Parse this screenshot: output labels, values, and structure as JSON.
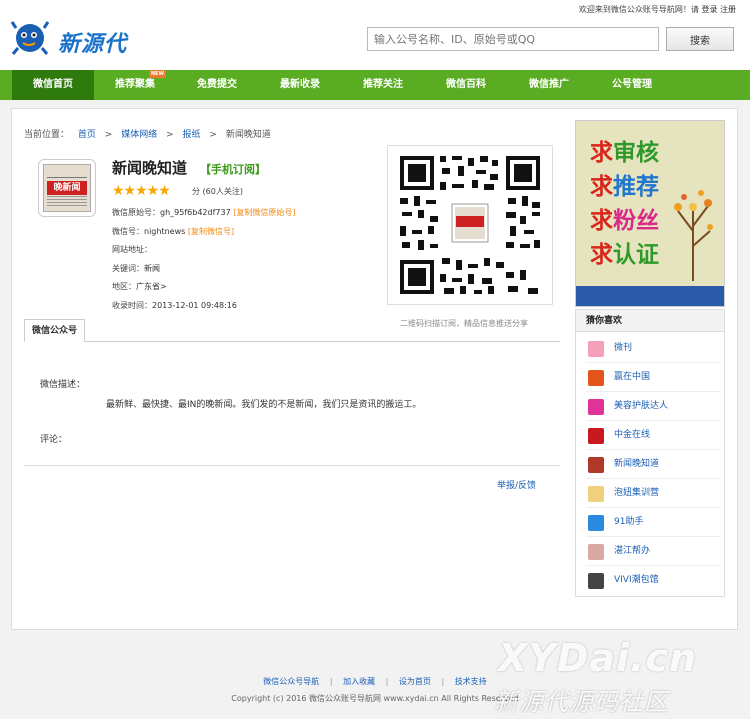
{
  "header": {
    "welcome": "欢迎来到微信公众账号导航网！请",
    "login": "登录",
    "register": "注册",
    "logo_text": "新源代",
    "search_placeholder": "输入公号名称、ID、原始号或QQ",
    "search_button": "搜索"
  },
  "nav": {
    "items": [
      {
        "label": "微信首页"
      },
      {
        "label": "推荐聚集",
        "badge": "NEW"
      },
      {
        "label": "免费提交"
      },
      {
        "label": "最新收录"
      },
      {
        "label": "推荐关注"
      },
      {
        "label": "微信百科"
      },
      {
        "label": "微信推广"
      },
      {
        "label": "公号管理"
      }
    ]
  },
  "breadcrumb": {
    "prefix": "当前位置：",
    "items": [
      "首页",
      "媒体网络",
      "报纸",
      "新闻晚知道"
    ],
    "sep": ">"
  },
  "account": {
    "icon_text": "晚新闻",
    "name": "新闻晚知道",
    "subscribe": "【手机订阅】",
    "stars": "★★★★★",
    "rating_text": "分 (60人关注)",
    "original_id_label": "微信原始号：",
    "original_id": "gh_95f6b42df737",
    "copy_original": "[复制微信原始号]",
    "wechat_id_label": "微信号：",
    "wechat_id": "nightnews",
    "copy_wechat": "[复制微信号]",
    "website_label": "网站地址：",
    "website": "",
    "keywords_label": "关键词：",
    "keywords": "新闻",
    "region_label": "地区：",
    "region": "广东省>",
    "time_label": "收录时间：",
    "time": "2013-12-01 09:48:16",
    "qr_caption": "二维码扫描订阅，精品信息推送分享"
  },
  "tabs": {
    "active": "微信公众号"
  },
  "detail": {
    "desc_label": "微信描述：",
    "desc": "最新鲜、最快捷、最IN的晚新闻。我们发的不是新闻，我们只是资讯的搬运工。",
    "comment_label": "评论：",
    "report": "举报/反馈"
  },
  "ad": {
    "lines": [
      {
        "a": "求",
        "b": "审核",
        "color": "#2f9a2a"
      },
      {
        "a": "求",
        "b": "推荐",
        "color": "#2277cc"
      },
      {
        "a": "求",
        "b": "粉丝",
        "color": "#d92a8a"
      },
      {
        "a": "求",
        "b": "认证",
        "color": "#2f9a2a"
      }
    ]
  },
  "guess": {
    "title": "猜你喜欢",
    "items": [
      {
        "label": "微刊",
        "color": "#f5a0b8"
      },
      {
        "label": "赢在中国",
        "color": "#e2541b"
      },
      {
        "label": "美容护肤达人",
        "color": "#e0339a"
      },
      {
        "label": "中金在线",
        "color": "#c8191f"
      },
      {
        "label": "新闻晚知道",
        "color": "#b03a2a"
      },
      {
        "label": "泡妞集训营",
        "color": "#f0d07a"
      },
      {
        "label": "91助手",
        "color": "#2a8ae0"
      },
      {
        "label": "湛江帮办",
        "color": "#d9a8a0"
      },
      {
        "label": "VIVI潮包馆",
        "color": "#444444"
      }
    ]
  },
  "footer": {
    "links": [
      "微信公众号导航",
      "加入收藏",
      "设为首页",
      "技术支持"
    ],
    "sep": "|",
    "copyright": "Copyright (c) 2016 微信公众账号导航网 www.xydai.cn All Rights Reserved",
    "watermark": "XYDai.cn",
    "watermark_sub": "新源代源码社区"
  }
}
